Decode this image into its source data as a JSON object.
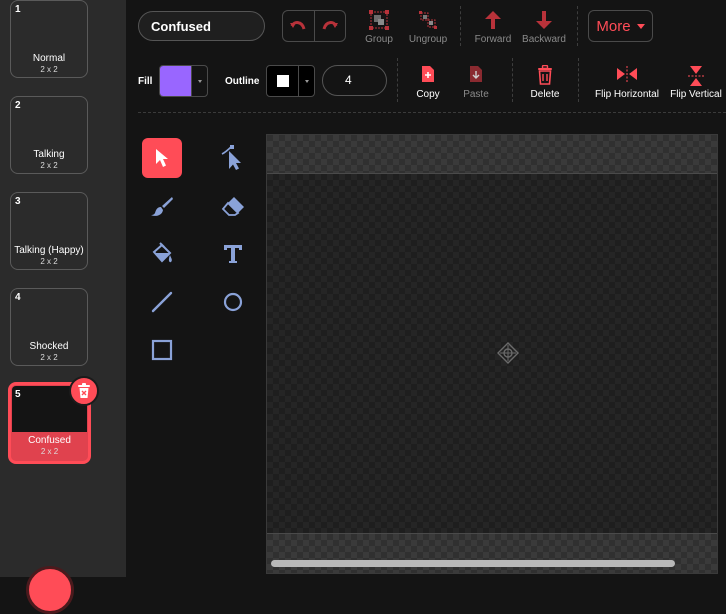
{
  "costumes": [
    {
      "number": "1",
      "name": "Normal",
      "size": "2 x 2"
    },
    {
      "number": "2",
      "name": "Talking",
      "size": "2 x 2"
    },
    {
      "number": "3",
      "name": "Talking (Happy)",
      "size": "2 x 2"
    },
    {
      "number": "4",
      "name": "Shocked",
      "size": "2 x 2"
    },
    {
      "number": "5",
      "name": "Confused",
      "size": "2 x 2",
      "selected": true
    }
  ],
  "toolbar": {
    "costume_name": "Confused",
    "group_label": "Group",
    "ungroup_label": "Ungroup",
    "forward_label": "Forward",
    "backward_label": "Backward",
    "more_label": "More",
    "fill_label": "Fill",
    "outline_label": "Outline",
    "outline_width": "4",
    "copy_label": "Copy",
    "paste_label": "Paste",
    "delete_label": "Delete",
    "flip_h_label": "Flip Horizontal",
    "flip_v_label": "Flip Vertical"
  },
  "colors": {
    "accent": "#ff4c57",
    "fill_color": "#9966ff",
    "outline_color": "#ffffff",
    "tool_icon": "#8aa2d8"
  },
  "tools": [
    "select-tool",
    "reshape-tool",
    "brush-tool",
    "eraser-tool",
    "fill-tool",
    "text-tool",
    "line-tool",
    "circle-tool",
    "rectangle-tool"
  ]
}
